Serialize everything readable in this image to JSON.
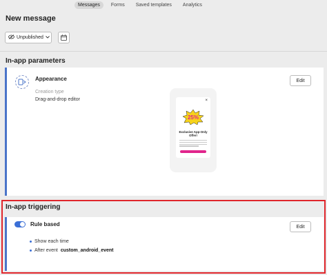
{
  "topnav": {
    "items": [
      "Messages",
      "Forms",
      "Saved templates",
      "Analytics"
    ],
    "active_index": 0
  },
  "page": {
    "title": "New message"
  },
  "toolbar": {
    "status_value": "Unpublished",
    "status_icon": "eye-slash-icon",
    "calendar_icon": "calendar-icon"
  },
  "parameters": {
    "section_title": "In-app parameters",
    "appearance_title": "Appearance",
    "creation_type_label": "Creation type",
    "creation_type_value": "Drag-and-drop editor",
    "edit_label": "Edit",
    "preview": {
      "close_glyph": "×",
      "badge_text": "25%",
      "headline": "Exclusive App-Only Offer!",
      "accent_color": "#e0258c"
    }
  },
  "triggering": {
    "section_title": "In-app triggering",
    "rule_title": "Rule based",
    "toggle_on": true,
    "edit_label": "Edit",
    "show_label": "Show each time",
    "after_event_prefix": "After event",
    "after_event_name": "custom_android_event",
    "highlight_color": "#e0252b"
  },
  "colors": {
    "accent": "#3b6fd6",
    "card_border": "#4a74c9"
  }
}
